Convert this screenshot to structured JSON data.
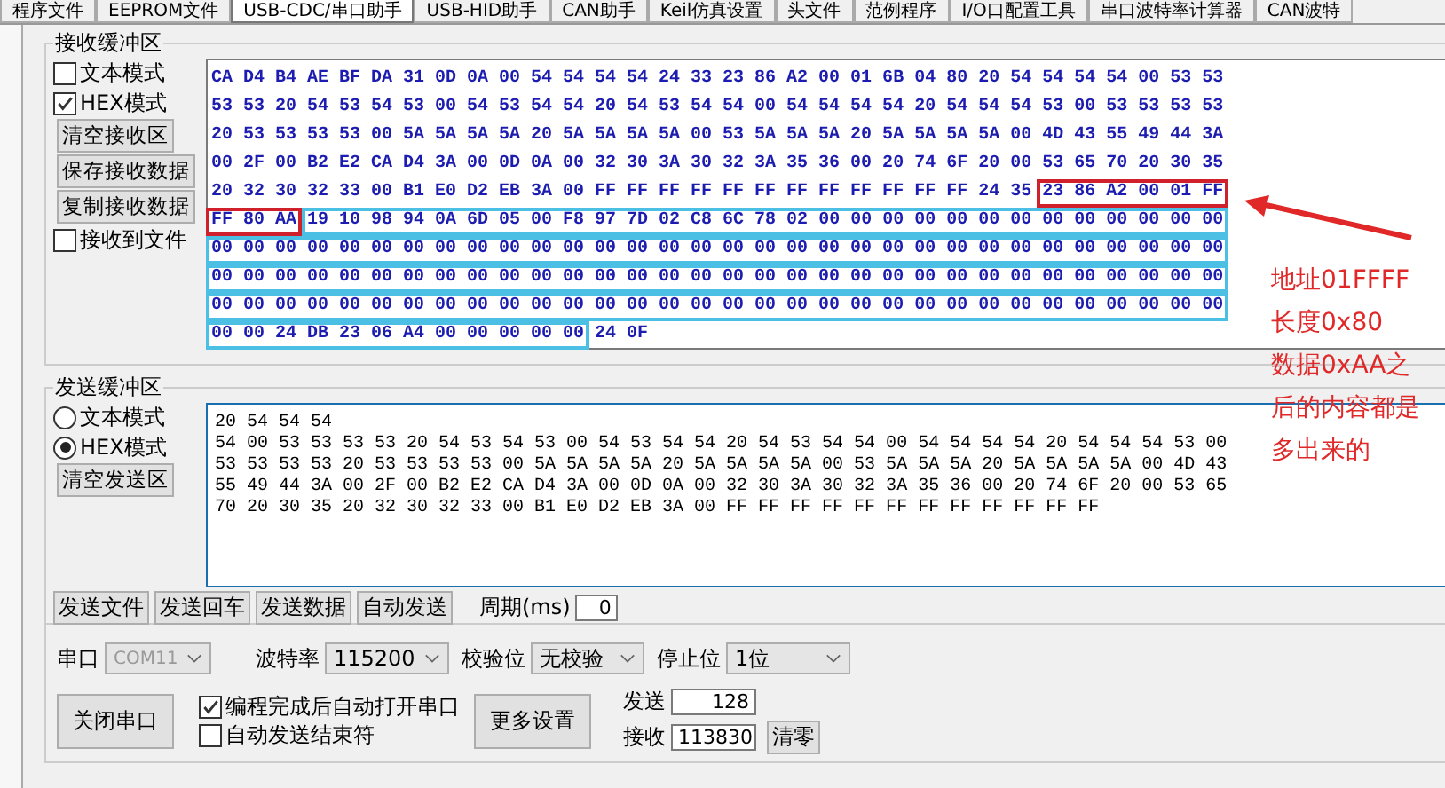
{
  "tabs": [
    {
      "label": "程序文件",
      "selected": false
    },
    {
      "label": "EEPROM文件",
      "selected": false
    },
    {
      "label": "USB-CDC/串口助手",
      "selected": true
    },
    {
      "label": "USB-HID助手",
      "selected": false
    },
    {
      "label": "CAN助手",
      "selected": false
    },
    {
      "label": "Keil仿真设置",
      "selected": false
    },
    {
      "label": "头文件",
      "selected": false
    },
    {
      "label": "范例程序",
      "selected": false
    },
    {
      "label": "I/O口配置工具",
      "selected": false
    },
    {
      "label": "串口波特率计算器",
      "selected": false
    },
    {
      "label": "CAN波特",
      "selected": false
    }
  ],
  "receive": {
    "title": "接收缓冲区",
    "text_mode": {
      "label": "文本模式",
      "checked": false
    },
    "hex_mode": {
      "label": "HEX模式",
      "checked": true
    },
    "buttons": [
      "清空接收区",
      "保存接收数据",
      "复制接收数据"
    ],
    "to_file": {
      "label": "接收到文件",
      "checked": false
    },
    "lines": [
      {
        "segments": [
          {
            "text": "CA D4 B4 AE BF DA 31 0D 0A 00 54 54 54 54 24 33 23 86 A2 00 01 6B 04 80 20 54 54 54 54 00 53 53",
            "kind": "plain"
          }
        ]
      },
      {
        "segments": [
          {
            "text": "53 53 20 54 53 54 53 00 54 53 54 54 20 54 53 54 54 00 54 54 54 54 20 54 54 54 53 00 53 53 53 53",
            "kind": "plain"
          }
        ]
      },
      {
        "segments": [
          {
            "text": "20 53 53 53 53 00 5A 5A 5A 5A 20 5A 5A 5A 5A 00 53 5A 5A 5A 20 5A 5A 5A 5A 00 4D 43 55 49 44 3A",
            "kind": "plain"
          }
        ]
      },
      {
        "segments": [
          {
            "text": "00 2F 00 B2 E2 CA D4 3A 00 0D 0A 00 32 30 3A 30 32 3A 35 36 00 20 74 6F 20 00 53 65 70 20 30 35",
            "kind": "plain"
          }
        ]
      },
      {
        "segments": [
          {
            "text": "20 32 30 32 33 00 B1 E0 D2 EB 3A 00 FF FF FF FF FF FF FF FF FF FF FF FF 24 35",
            "kind": "plain"
          },
          {
            "text": "23 86 A2 00 01 FF",
            "kind": "address"
          }
        ]
      },
      {
        "segments": [
          {
            "text": "FF 80 AA",
            "kind": "address"
          },
          {
            "text": "19 10 98 94 0A 6D 05 00 F8 97 7D 02 C8 6C 78 02 00 00 00 00 00 00 00 00 00 00 00 00 00",
            "kind": "extra"
          }
        ]
      },
      {
        "segments": [
          {
            "text": "00 00 00 00 00 00 00 00 00 00 00 00 00 00 00 00 00 00 00 00 00 00 00 00 00 00 00 00 00 00 00 00",
            "kind": "extra"
          }
        ]
      },
      {
        "segments": [
          {
            "text": "00 00 00 00 00 00 00 00 00 00 00 00 00 00 00 00 00 00 00 00 00 00 00 00 00 00 00 00 00 00 00 00",
            "kind": "extra"
          }
        ]
      },
      {
        "segments": [
          {
            "text": "00 00 00 00 00 00 00 00 00 00 00 00 00 00 00 00 00 00 00 00 00 00 00 00 00 00 00 00 00 00 00 00",
            "kind": "extra"
          }
        ]
      },
      {
        "segments": [
          {
            "text": "00 00 24 DB 23 06 A4 00 00 00 00 00",
            "kind": "extra"
          },
          {
            "text": "24 0F",
            "kind": "plain"
          }
        ]
      }
    ]
  },
  "send": {
    "title": "发送缓冲区",
    "modes": [
      {
        "label": "文本模式",
        "selected": false
      },
      {
        "label": "HEX模式",
        "selected": true
      }
    ],
    "clear_button": "清空发送区",
    "lines": [
      "20 54 54 54",
      "54 00 53 53 53 53 20 54 53 54 53 00 54 53 54 54 20 54 53 54 54 00 54 54 54 54 20 54 54 54 53 00",
      "53 53 53 53 20 53 53 53 53 00 5A 5A 5A 5A 20 5A 5A 5A 5A 00 53 5A 5A 5A 20 5A 5A 5A 5A 00 4D 43",
      "55 49 44 3A 00 2F 00 B2 E2 CA D4 3A 00 0D 0A 00 32 30 3A 30 32 3A 35 36 00 20 74 6F 20 00 53 65",
      "70 20 30 35 20 32 30 32 33 00 B1 E0 D2 EB 3A 00 FF FF FF FF FF FF FF FF FF FF FF FF"
    ],
    "buttons": [
      "发送文件",
      "发送回车",
      "发送数据",
      "自动发送"
    ],
    "period_label": "周期(ms)",
    "period_value": "0"
  },
  "port": {
    "port_label": "串口",
    "port_value": "COM11",
    "port_disabled": true,
    "baud_label": "波特率",
    "baud_value": "115200",
    "parity_label": "校验位",
    "parity_value": "无校验",
    "stop_label": "停止位",
    "stop_value": "1位",
    "close_button": "关闭串口",
    "options": [
      {
        "label": "编程完成后自动打开串口",
        "checked": true
      },
      {
        "label": "自动发送结束符",
        "checked": false
      }
    ],
    "more_button": "更多设置",
    "sent_label": "发送",
    "sent_value": "128",
    "received_label": "接收",
    "received_value": "113830",
    "reset_button": "清零"
  },
  "annotation": {
    "lines": [
      "地址01FFFF",
      "长度0x80",
      "数据0xAA之",
      "后的内容都是",
      "多出来的"
    ]
  }
}
